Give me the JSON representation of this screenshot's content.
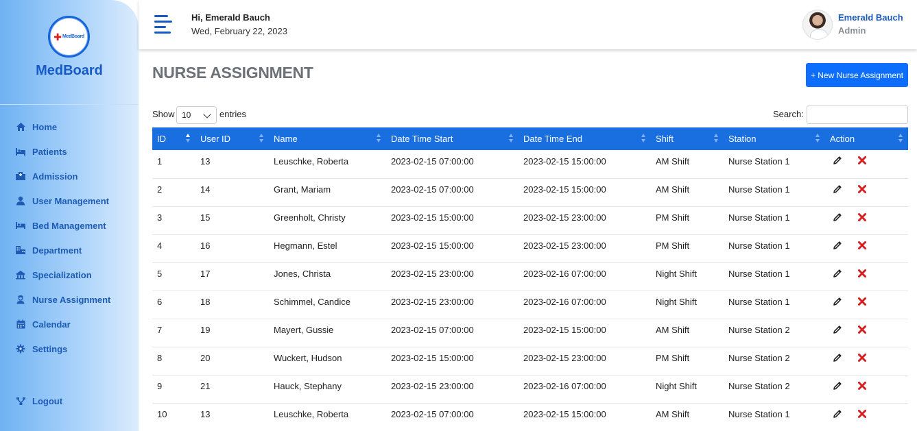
{
  "sidebar": {
    "logo_mini": "MedBoard",
    "brand": "MedBoard",
    "items": [
      {
        "label": "Home",
        "icon": "home-icon"
      },
      {
        "label": "Patients",
        "icon": "patients-icon"
      },
      {
        "label": "Admission",
        "icon": "admission-icon"
      },
      {
        "label": "User Management",
        "icon": "user-icon"
      },
      {
        "label": "Bed Management",
        "icon": "bed-icon"
      },
      {
        "label": "Department",
        "icon": "department-icon"
      },
      {
        "label": "Specialization",
        "icon": "specialization-icon"
      },
      {
        "label": "Nurse Assignment",
        "icon": "nurse-icon"
      },
      {
        "label": "Calendar",
        "icon": "calendar-icon"
      },
      {
        "label": "Settings",
        "icon": "gear-icon"
      }
    ],
    "logout": "Logout"
  },
  "header": {
    "greeting": "Hi, Emerald Bauch",
    "date": "Wed, February 22, 2023",
    "user_name": "Emerald Bauch",
    "user_role": "Admin"
  },
  "main": {
    "title": "NURSE ASSIGNMENT",
    "new_button": "+ New Nurse Assignment",
    "show_label": "Show",
    "entries_value": "10",
    "entries_label": "entries",
    "search_label": "Search:",
    "search_value": ""
  },
  "table": {
    "headers": [
      "ID",
      "User ID",
      "Name",
      "Date Time Start",
      "Date Time End",
      "Shift",
      "Station",
      "Action"
    ],
    "rows": [
      [
        "1",
        "13",
        "Leuschke, Roberta",
        "2023-02-15 07:00:00",
        "2023-02-15 15:00:00",
        "AM Shift",
        "Nurse Station 1"
      ],
      [
        "2",
        "14",
        "Grant, Mariam",
        "2023-02-15 07:00:00",
        "2023-02-15 15:00:00",
        "AM Shift",
        "Nurse Station 1"
      ],
      [
        "3",
        "15",
        "Greenholt, Christy",
        "2023-02-15 15:00:00",
        "2023-02-15 23:00:00",
        "PM Shift",
        "Nurse Station 1"
      ],
      [
        "4",
        "16",
        "Hegmann, Estel",
        "2023-02-15 15:00:00",
        "2023-02-15 23:00:00",
        "PM Shift",
        "Nurse Station 1"
      ],
      [
        "5",
        "17",
        "Jones, Christa",
        "2023-02-15 23:00:00",
        "2023-02-16 07:00:00",
        "Night Shift",
        "Nurse Station 1"
      ],
      [
        "6",
        "18",
        "Schimmel, Candice",
        "2023-02-15 23:00:00",
        "2023-02-16 07:00:00",
        "Night Shift",
        "Nurse Station 1"
      ],
      [
        "7",
        "19",
        "Mayert, Gussie",
        "2023-02-15 07:00:00",
        "2023-02-15 15:00:00",
        "AM Shift",
        "Nurse Station 2"
      ],
      [
        "8",
        "20",
        "Wuckert, Hudson",
        "2023-02-15 15:00:00",
        "2023-02-15 23:00:00",
        "PM Shift",
        "Nurse Station 2"
      ],
      [
        "9",
        "21",
        "Hauck, Stephany",
        "2023-02-15 23:00:00",
        "2023-02-16 07:00:00",
        "Night Shift",
        "Nurse Station 2"
      ],
      [
        "10",
        "13",
        "Leuschke, Roberta",
        "2023-02-15 07:00:00",
        "2023-02-15 15:00:00",
        "AM Shift",
        "Nurse Station 1"
      ]
    ]
  },
  "colors": {
    "primary": "#1a6fe0",
    "button": "#0d6efd",
    "nav_text": "#1d5bb5",
    "delete": "#d42020"
  }
}
